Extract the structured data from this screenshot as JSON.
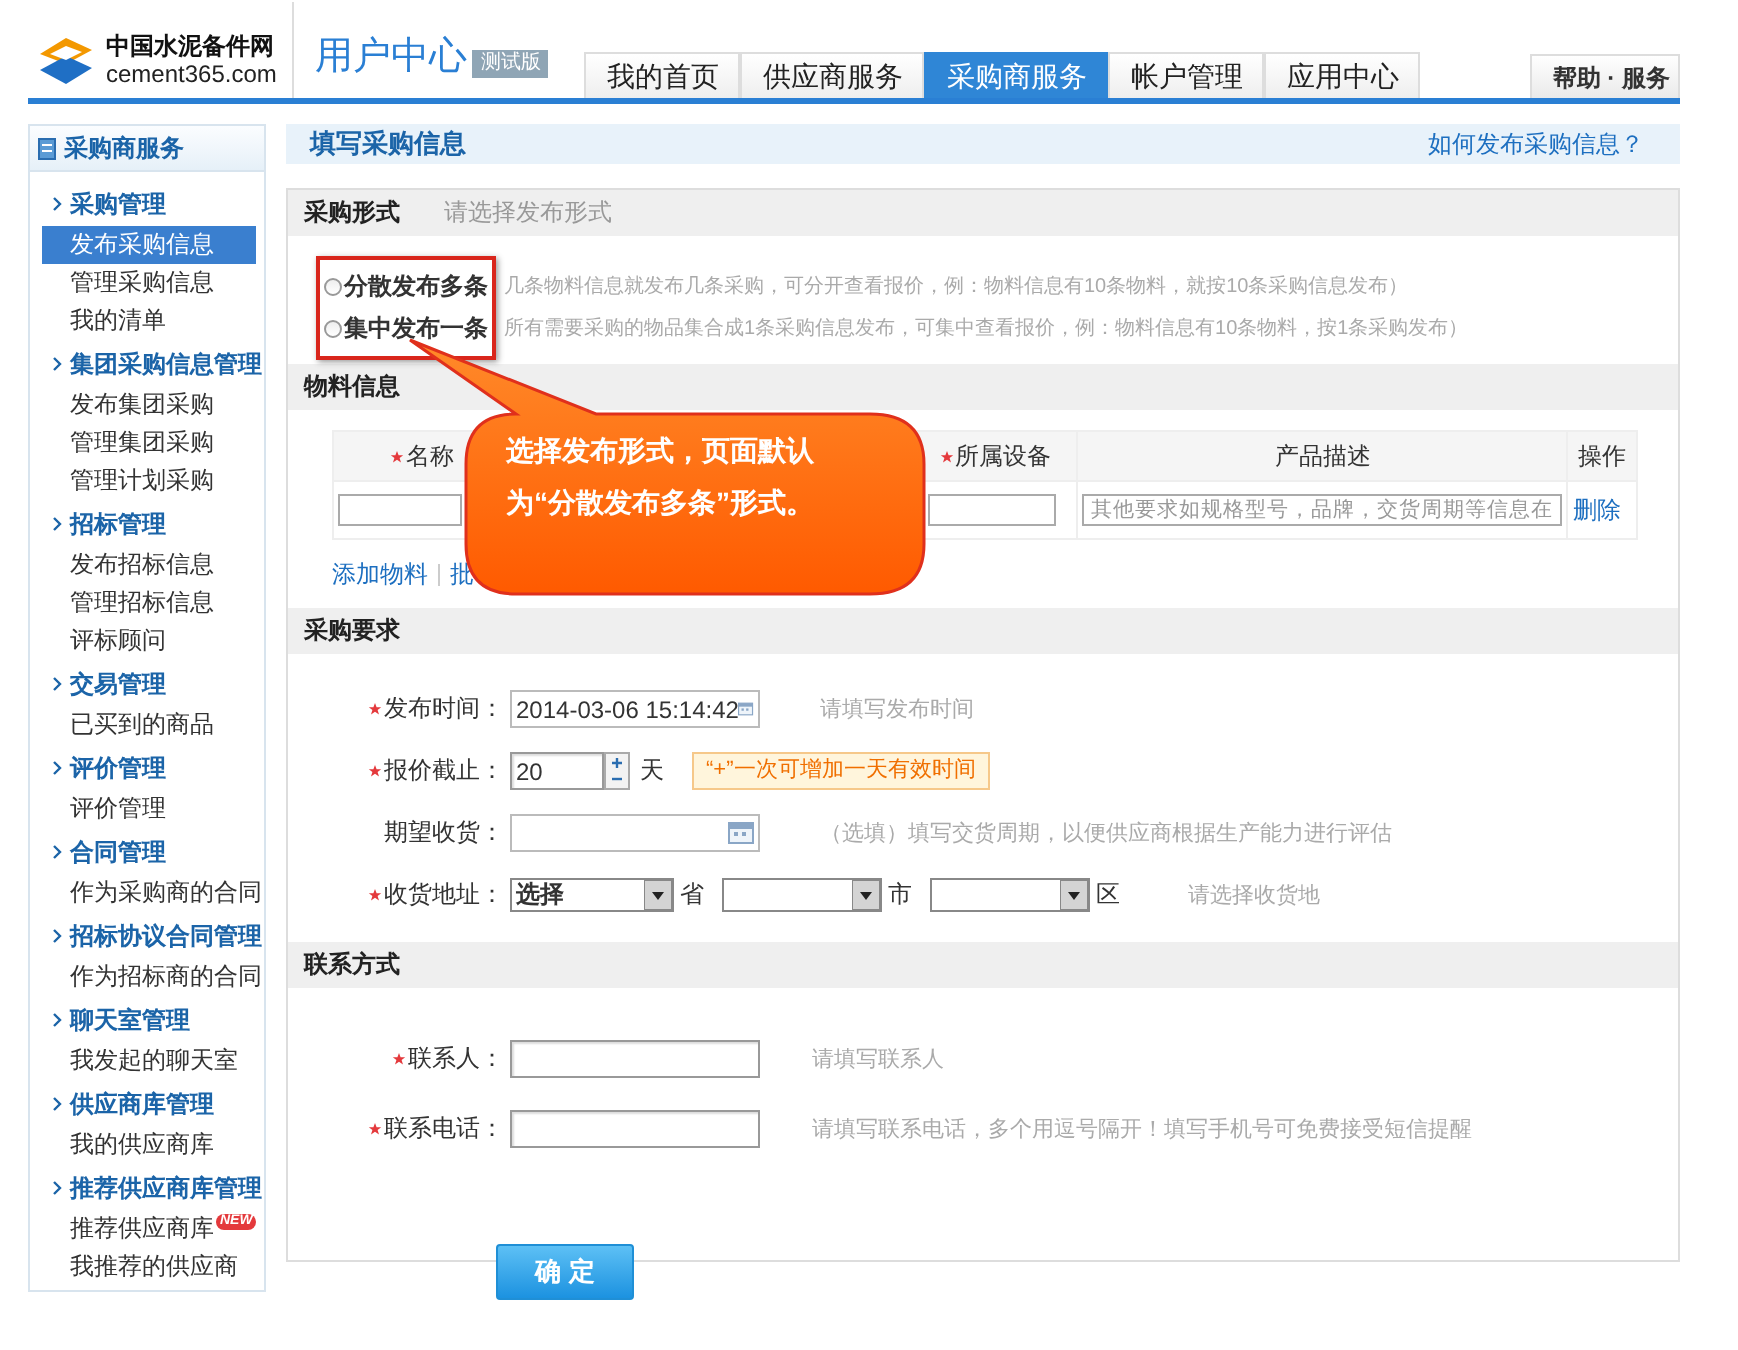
{
  "header": {
    "logo_cn": "中国水泥备件网",
    "logo_en": "cement365.com",
    "title": "用户中心",
    "badge": "测试版",
    "help": "帮助 · 服务",
    "tabs": [
      {
        "label": "我的首页",
        "selected": false
      },
      {
        "label": "供应商服务",
        "selected": false
      },
      {
        "label": "采购商服务",
        "selected": true
      },
      {
        "label": "帐户管理",
        "selected": false
      },
      {
        "label": "应用中心",
        "selected": false
      }
    ]
  },
  "sidebar": {
    "title": "采购商服务",
    "groups": [
      {
        "label": "采购管理",
        "items": [
          {
            "label": "发布采购信息",
            "selected": true
          },
          {
            "label": "管理采购信息",
            "selected": false
          },
          {
            "label": "我的清单",
            "selected": false
          }
        ]
      },
      {
        "label": "集团采购信息管理",
        "items": [
          {
            "label": "发布集团采购",
            "selected": false
          },
          {
            "label": "管理集团采购",
            "selected": false
          },
          {
            "label": "管理计划采购",
            "selected": false
          }
        ]
      },
      {
        "label": "招标管理",
        "items": [
          {
            "label": "发布招标信息",
            "selected": false
          },
          {
            "label": "管理招标信息",
            "selected": false
          },
          {
            "label": "评标顾问",
            "selected": false
          }
        ]
      },
      {
        "label": "交易管理",
        "items": [
          {
            "label": "已买到的商品",
            "selected": false
          }
        ]
      },
      {
        "label": "评价管理",
        "items": [
          {
            "label": "评价管理",
            "selected": false
          }
        ]
      },
      {
        "label": "合同管理",
        "items": [
          {
            "label": "作为采购商的合同",
            "selected": false
          }
        ]
      },
      {
        "label": "招标协议合同管理",
        "items": [
          {
            "label": "作为招标商的合同",
            "selected": false
          }
        ]
      },
      {
        "label": "聊天室管理",
        "items": [
          {
            "label": "我发起的聊天室",
            "selected": false
          }
        ]
      },
      {
        "label": "供应商库管理",
        "items": [
          {
            "label": "我的供应商库",
            "selected": false
          }
        ]
      },
      {
        "label": "推荐供应商库管理",
        "items": [
          {
            "label": "推荐供应商库",
            "selected": false,
            "badge": "NEW"
          },
          {
            "label": "我推荐的供应商",
            "selected": false
          }
        ]
      }
    ]
  },
  "page_title": "填写采购信息",
  "help_link": "如何发布采购信息？",
  "sections": [
    {
      "kind": "options",
      "title": "采购形式",
      "hint": "请选择发布形式",
      "options": [
        {
          "label": "分散发布多条",
          "selected": false,
          "description": "几条物料信息就发布几条采购，可分开查看报价，例：物料信息有10条物料，就按10条采购信息发布）"
        },
        {
          "label": "集中发布一条",
          "selected": false,
          "description": "所有需要采购的物品集合成1条采购信息发布，可集中查看报价，例：物料信息有10条物料，按1条采购发布）"
        }
      ]
    },
    {
      "kind": "material",
      "title": "物料信息",
      "columns": [
        {
          "label": "名称",
          "required": true
        },
        {
          "label": "所属设备",
          "required": true
        },
        {
          "label": "产品描述",
          "required": false
        },
        {
          "label": "操作",
          "required": false
        }
      ],
      "row": {
        "description_placeholder": "其他要求如规格型号，品牌，交货周期等信息在",
        "action": "删除"
      },
      "links": [
        "添加物料",
        "批"
      ]
    },
    {
      "kind": "fields",
      "title": "采购要求",
      "fields": [
        {
          "kind": "date",
          "label": "发布时间：",
          "required": true,
          "value": "2014-03-06 15:14:42",
          "hint": "请填写发布时间"
        },
        {
          "kind": "spinner",
          "label": "报价截止：",
          "required": true,
          "value": "20",
          "unit": "天",
          "tip": "“+”一次可增加一天有效时间"
        },
        {
          "kind": "date",
          "label": "期望收货：",
          "required": false,
          "hint": "（选填）填写交货周期，以便供应商根据生产能力进行评估"
        },
        {
          "kind": "address",
          "label": "收货地址：",
          "required": true,
          "selects": [
            {
              "value": "选择",
              "unit": "省"
            },
            {
              "unit": "市"
            },
            {
              "unit": "区"
            }
          ],
          "hint": "请选择收货地"
        }
      ]
    },
    {
      "kind": "fields",
      "title": "联系方式",
      "fields": [
        {
          "kind": "text",
          "label": "联系人：",
          "required": true,
          "hint": "请填写联系人"
        },
        {
          "kind": "text",
          "label": "联系电话：",
          "required": true,
          "hint": "请填写联系电话，多个用逗号隔开！填写手机号可免费接受短信提醒"
        }
      ]
    }
  ],
  "submit": "确 定",
  "callout": "选择发布形式，页面默认为“分散发布多条”形式。"
}
